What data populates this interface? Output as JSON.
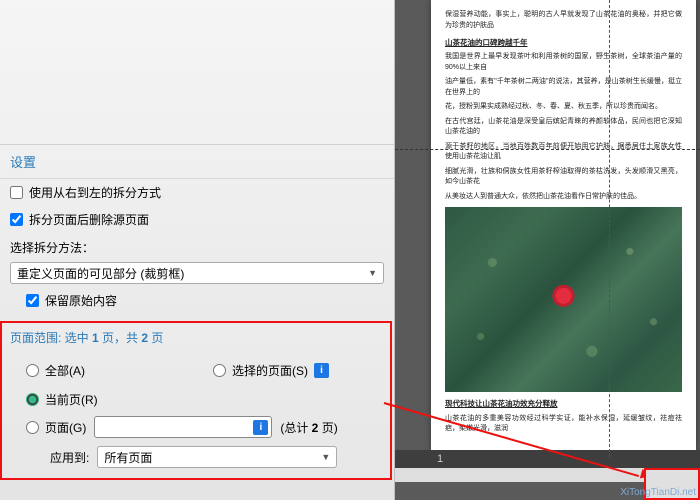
{
  "panel": {
    "settings_header": "设置",
    "opt_rtl": "使用从右到左的拆分方式",
    "opt_delete_source": "拆分页面后删除源页面",
    "method_label": "选择拆分方法：",
    "method_selected": "重定义页面的可见部分 (裁剪框)",
    "keep_original": "保留原始内容"
  },
  "range": {
    "header_prefix": "页面范围: 选中 ",
    "header_mid": " 页，共 ",
    "header_suffix": " 页",
    "selected": "1",
    "total": "2",
    "radio_all": "全部(A)",
    "radio_selected": "选择的页面(S)",
    "radio_current": "当前页(R)",
    "radio_pages": "页面(G)",
    "pages_total_prefix": "(总计 ",
    "pages_total_suffix": " 页)",
    "pages_total_n": "2",
    "apply_label": "应用到:",
    "apply_selected": "所有页面"
  },
  "doc": {
    "para0": "保湿营养动能，事实上，聪明的古人早就发现了山茶花油的奥秘，并把它做为珍贵的护肤品",
    "h1": "山茶花油的口碑跨越千年",
    "para1": "我国是世界上最早发现茶叶和利用茶树的国家，野生茶树，全球茶油产量的90%以上来自",
    "para2": "油产量低，素有\"千年茶树二两油\"的说法，其营养，是山茶树生长缓慢，挺立在世界上的",
    "para3": "花，授粉到果实成熟经过秋、冬、春、夏、秋五季，所以珍贵而闻名。",
    "para4": "在古代宫廷，山茶花油是深受皇后嫔妃青睐的养颜软体品，民间也把它深知山茶花油的",
    "para5": "源于茶籽的地区，当地百姓数百年前便开始用它护肤，据悉居住土家族女性使用山茶花油让肌",
    "para6": "细腻光滑，壮族和侗族女性用茶籽榨油取得的茶枯洗发，头发顺滑又黑亮，如今山茶花",
    "para7": "从美妆达人到普通大众，依然把山茶花油看作日常护肤的佳品。",
    "h2": "现代科技让山茶花油功效充分释放",
    "para_end": "山茶花油的多重美容功效经过科学实证，能补水保湿，延缓皱纹，祛痘祛疤，柔嫩光滑，滋润"
  },
  "thumb": {
    "page_number": "1"
  },
  "watermark": "XiTongTianDi.net"
}
